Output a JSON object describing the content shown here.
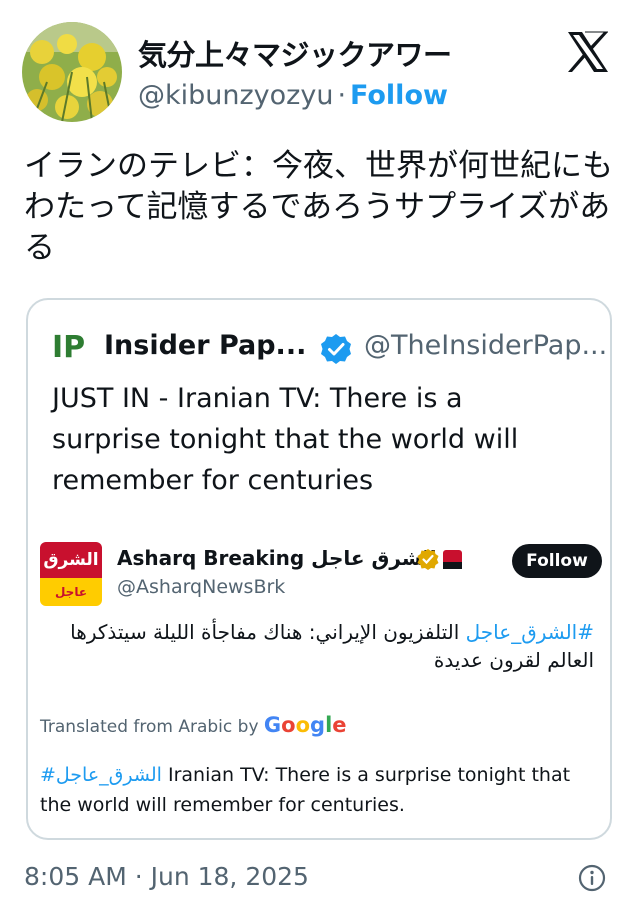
{
  "author": {
    "name": "気分上々マジックアワー",
    "handle": "@kibunzyozyu",
    "separator": "·",
    "follow_label": "Follow"
  },
  "tweet": {
    "text": "イランのテレビ：今夜、世界が何世紀にもわたって記憶するであろうサプライズがある"
  },
  "quote": {
    "logo_text": "IP",
    "name": "Insider Pap...",
    "handle": "@TheInsiderPap...",
    "text": "JUST IN - Iranian TV: There is a surprise tonight that the world will remember for centuries",
    "embed": {
      "logo_top": "الشرق",
      "logo_bottom": "عاجل",
      "name": "Asharq Breaking الشرق عاجل",
      "handle": "@AsharqNewsBrk",
      "follow_label": "Follow",
      "arabic_hashtag": "#الشرق_عاجل",
      "arabic_text": " التلفزيون الإيراني: هناك مفاجأة الليلة سيتذكرها العالم لقرون عديدة",
      "translated_label": "Translated from Arabic by",
      "google": [
        "G",
        "o",
        "o",
        "g",
        "l",
        "e"
      ],
      "translation_hashtag": "#الشرق_عاجل",
      "translation_text": " Iranian TV: There is a surprise tonight that the world will remember for centuries."
    }
  },
  "footer": {
    "timestamp": "8:05 AM · Jun 18, 2025"
  },
  "icons": {
    "x_logo": "x-logo-icon",
    "verified": "verified-badge-icon",
    "info": "info-icon"
  },
  "colors": {
    "link": "#1d9bf0",
    "secondary_text": "#536471",
    "asharq_red": "#c8102e",
    "asharq_yellow": "#ffcc00"
  }
}
